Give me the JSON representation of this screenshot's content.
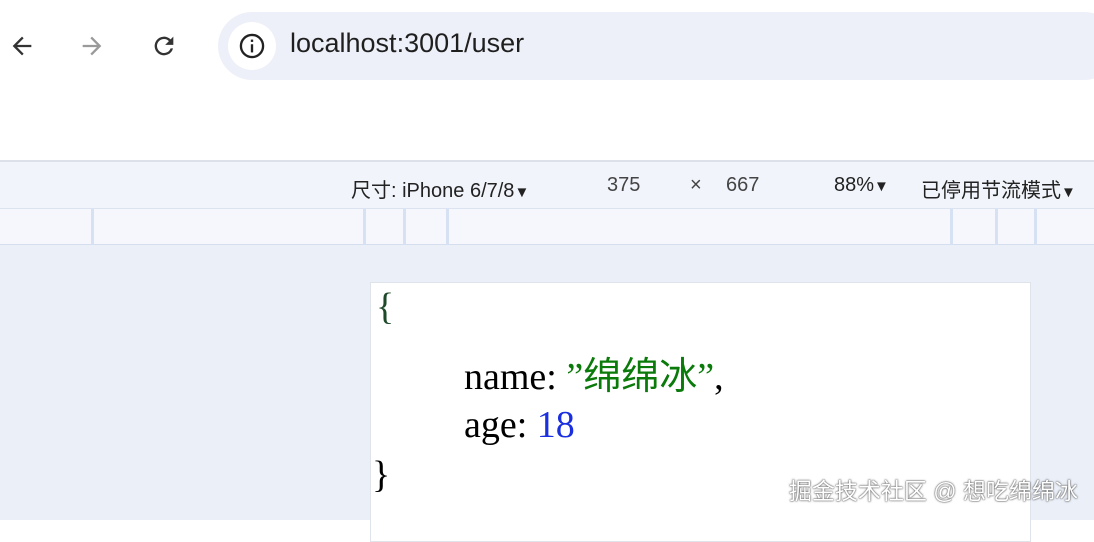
{
  "browser": {
    "url": "localhost:3001/user"
  },
  "device_toolbar": {
    "dimensions_label": "尺寸: iPhone 6/7/8",
    "width": "375",
    "times": "×",
    "height": "667",
    "zoom": "88%",
    "throttling": "已停用节流模式",
    "dropdown_glyph": "▼"
  },
  "page": {
    "open_brace": "{",
    "name_key": "name: ",
    "name_value": "”绵绵冰”",
    "comma": ",",
    "age_key": "age: ",
    "age_value": "18",
    "close_brace": "}"
  },
  "watermark": "掘金技术社区 @ 想吃绵绵冰",
  "colors": {
    "string": "#0a7a0a",
    "number": "#1a2fe0"
  }
}
